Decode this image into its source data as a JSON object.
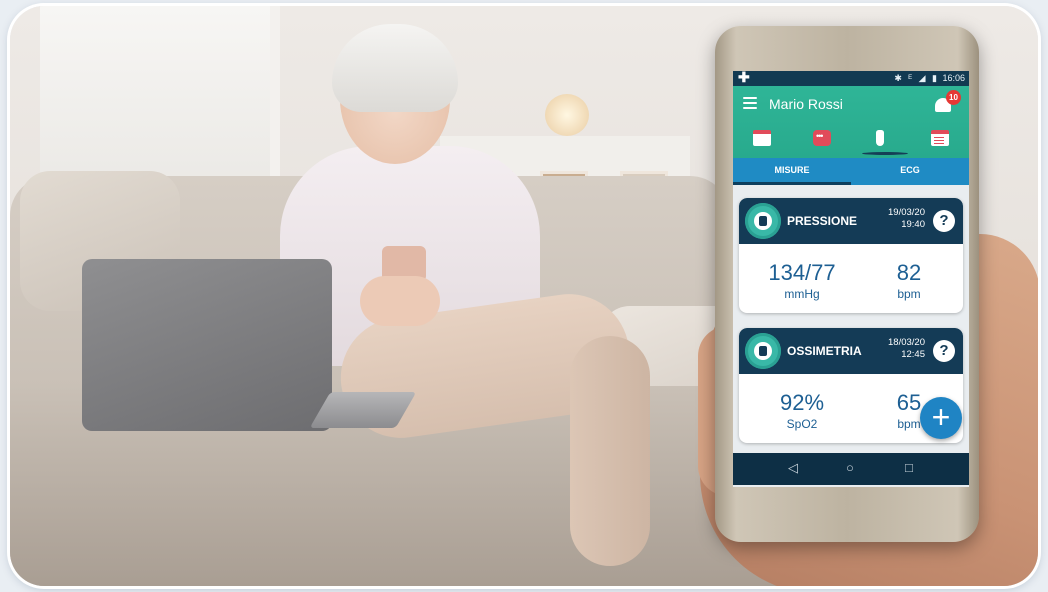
{
  "app": {
    "status_bar": {
      "indicators": "✱ ᴱ ◢ ▮",
      "time": "16:06"
    },
    "header": {
      "user_name": "Mario Rossi",
      "notification_count": "10"
    },
    "top_icons": [
      "calendar-icon",
      "chat-icon",
      "thermometer-icon",
      "clipboard-icon"
    ],
    "tabs": [
      "MISURE",
      "ECG"
    ],
    "cards": [
      {
        "title": "PRESSIONE",
        "date": "19/03/20",
        "time": "19:40",
        "value_1": "134/77",
        "unit_1": "mmHg",
        "value_2": "82",
        "unit_2": "bpm"
      },
      {
        "title": "OSSIMETRIA",
        "date": "18/03/20",
        "time": "12:45",
        "value_1": "92%",
        "unit_1": "SpO2",
        "value_2": "65",
        "unit_2": "bpm"
      }
    ],
    "fab_symbol": "+",
    "nav_buttons": [
      "◁",
      "○",
      "□"
    ],
    "colors": {
      "header": "#2fb597",
      "tabs": "#1f8bc4",
      "card_header": "#143b56",
      "value_text": "#1d5f93",
      "accent_red": "#e14b5a"
    }
  }
}
